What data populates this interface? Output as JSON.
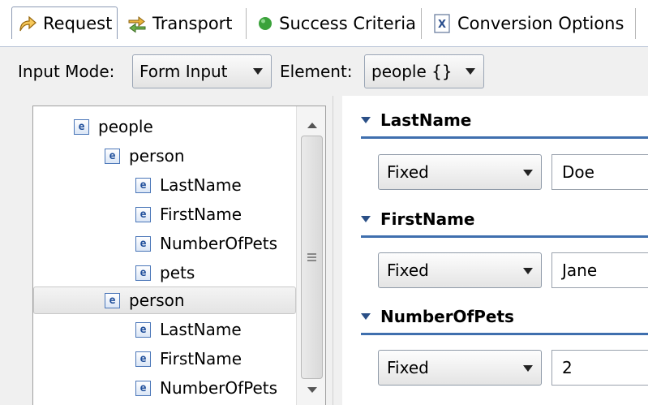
{
  "tabs": [
    {
      "label": "Request",
      "icon": "request-arrow-icon",
      "active": true
    },
    {
      "label": "Transport",
      "icon": "transport-arrows-icon",
      "active": false
    },
    {
      "label": "Success Criteria",
      "icon": "green-dot-icon",
      "active": false
    },
    {
      "label": "Conversion Options",
      "icon": "xml-file-icon",
      "active": false
    }
  ],
  "mode_bar": {
    "input_mode_label": "Input Mode:",
    "input_mode_value": "Form Input",
    "element_label": "Element:",
    "element_value": "people {}"
  },
  "tree": {
    "element_badge": "e",
    "items": [
      {
        "label": "people",
        "depth": 0
      },
      {
        "label": "person",
        "depth": 1
      },
      {
        "label": "LastName",
        "depth": 2
      },
      {
        "label": "FirstName",
        "depth": 2
      },
      {
        "label": "NumberOfPets",
        "depth": 2
      },
      {
        "label": "pets",
        "depth": 2
      },
      {
        "label": "person",
        "depth": 1,
        "selected": true
      },
      {
        "label": "LastName",
        "depth": 2
      },
      {
        "label": "FirstName",
        "depth": 2
      },
      {
        "label": "NumberOfPets",
        "depth": 2
      }
    ]
  },
  "fields": [
    {
      "name": "LastName",
      "mode": "Fixed",
      "value": "Doe"
    },
    {
      "name": "FirstName",
      "mode": "Fixed",
      "value": "Jane"
    },
    {
      "name": "NumberOfPets",
      "mode": "Fixed",
      "value": "2"
    }
  ],
  "colors": {
    "accent": "#3f6fae",
    "panel_bg": "#f0f0f0",
    "success_dot": "#3aa23a"
  }
}
